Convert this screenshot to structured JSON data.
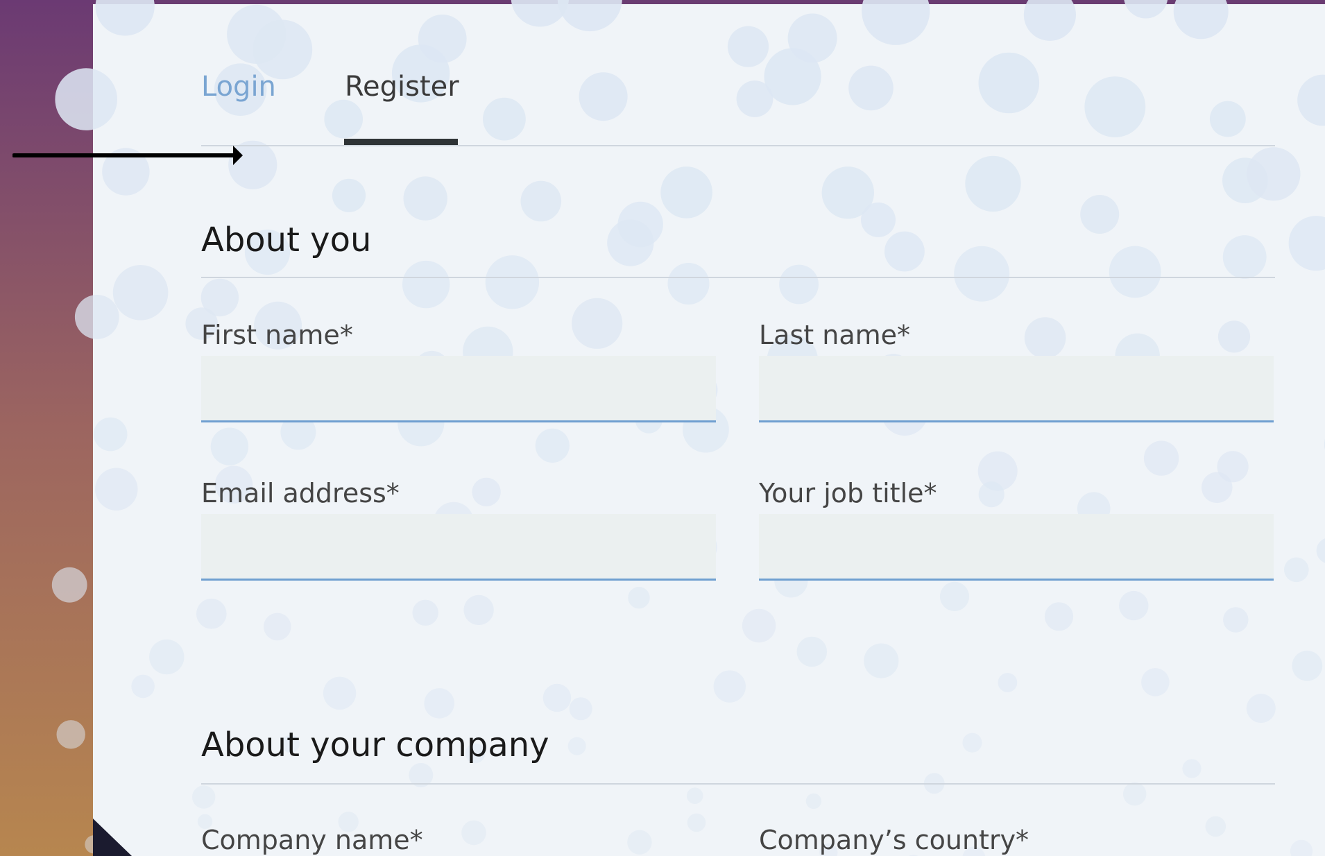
{
  "colors": {
    "gradient_top": "#6b3a73",
    "gradient_mid": "#9c6560",
    "gradient_bottom": "#b7864f",
    "panel_bg": "#f0f4f8",
    "dot_color": "#dde7f3",
    "tab_active_color": "#3a3a3a",
    "tab_inactive_color": "#7aa5d2",
    "tab_underline": "#2f3436",
    "rule_color": "#cfd6de",
    "heading_color": "#1a1a1a",
    "label_color": "#454545",
    "input_bg": "#ebf0f0",
    "input_border": "#6f9fd0",
    "arrow_color": "#000000",
    "corner_color": "#1b1b2f",
    "top_band": "#6a3c72"
  },
  "tabs": [
    {
      "label": "Login",
      "active": false
    },
    {
      "label": "Register",
      "active": true
    }
  ],
  "about_you": {
    "title": "About you",
    "fields": [
      {
        "label": "First name*",
        "value": ""
      },
      {
        "label": "Last name*",
        "value": ""
      },
      {
        "label": "Email address*",
        "value": ""
      },
      {
        "label": "Your job title*",
        "value": ""
      }
    ]
  },
  "about_company": {
    "title": "About your company",
    "fields": [
      {
        "label": "Company name*"
      },
      {
        "label": "Company’s country*"
      }
    ]
  }
}
